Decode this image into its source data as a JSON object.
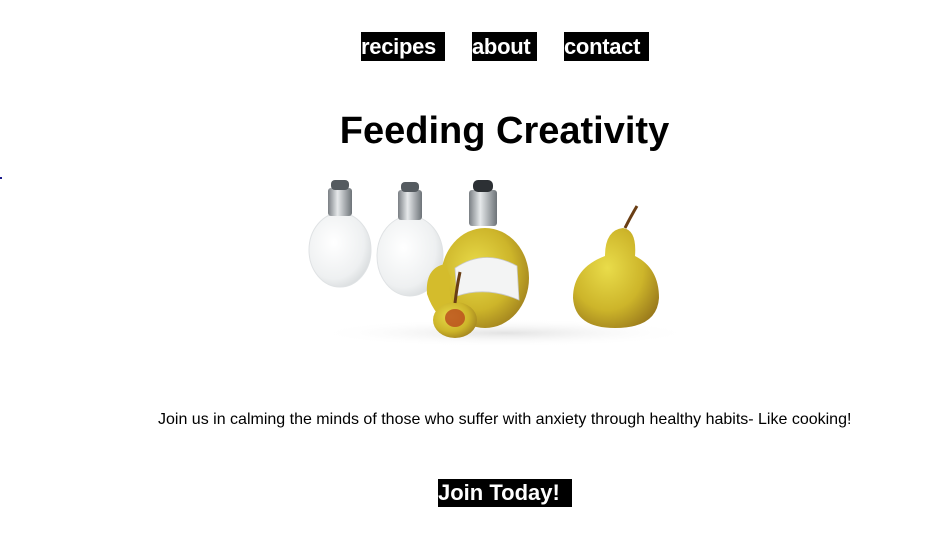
{
  "nav": {
    "items": [
      {
        "label": "recipes"
      },
      {
        "label": "about"
      },
      {
        "label": "contact"
      }
    ]
  },
  "hero": {
    "title": "Feeding Creativity",
    "image_icon": "light-bulbs-and-pears-image"
  },
  "main": {
    "tagline": "Join us in calming the minds of those who suffer with anxiety through healthy habits- Like cooking!"
  },
  "cta": {
    "label": "Join Today!"
  },
  "colors": {
    "background": "#ffffff",
    "button_bg": "#000000",
    "button_text": "#ffffff",
    "text": "#000000",
    "pear_yellow": "#d8c22a",
    "pear_brown": "#a06a1c"
  }
}
